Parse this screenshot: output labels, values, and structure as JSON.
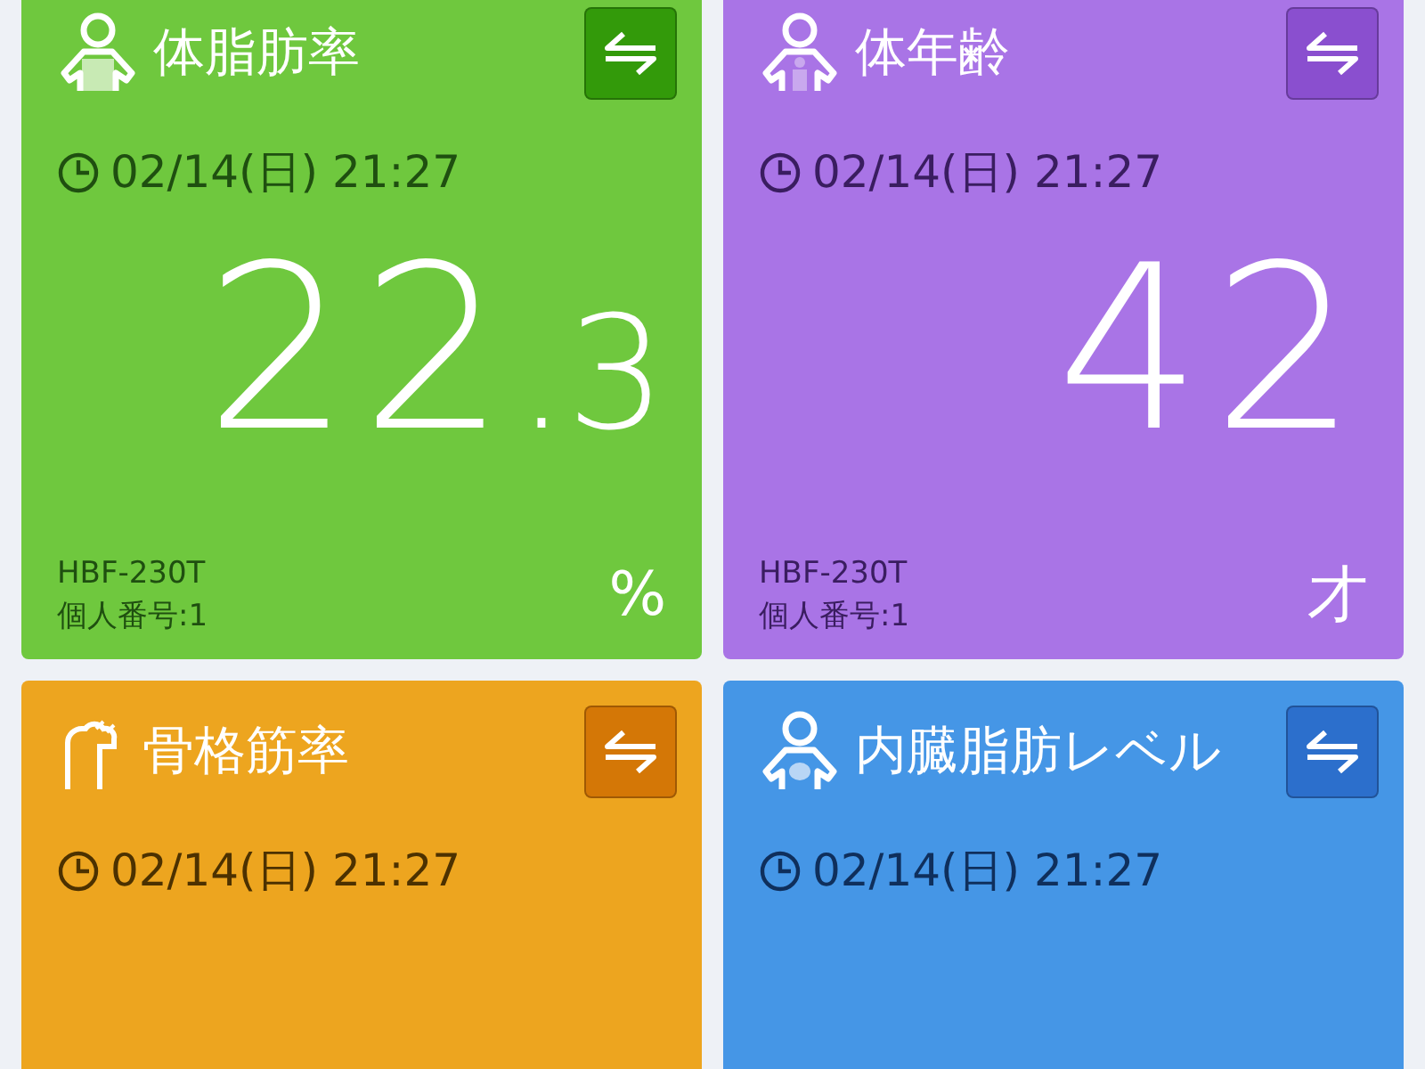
{
  "cards": [
    {
      "kind": "fat",
      "color": "#6fc83e",
      "title": "体脂肪率",
      "date": "02/14(日) 21:27",
      "value": "22",
      "decimal": ".3",
      "model": "HBF-230T",
      "person": "個人番号:1",
      "unit": "%"
    },
    {
      "kind": "age",
      "color": "#a974e6",
      "title": "体年齢",
      "date": "02/14(日) 21:27",
      "value": "42",
      "model": "HBF-230T",
      "person": "個人番号:1",
      "unit": "才"
    },
    {
      "kind": "muscle",
      "color": "#eda51f",
      "title": "骨格筋率",
      "date": "02/14(日) 21:27"
    },
    {
      "kind": "visceral",
      "color": "#4596e6",
      "title": "内臓脂肪レベル",
      "date": "02/14(日) 21:27"
    }
  ]
}
